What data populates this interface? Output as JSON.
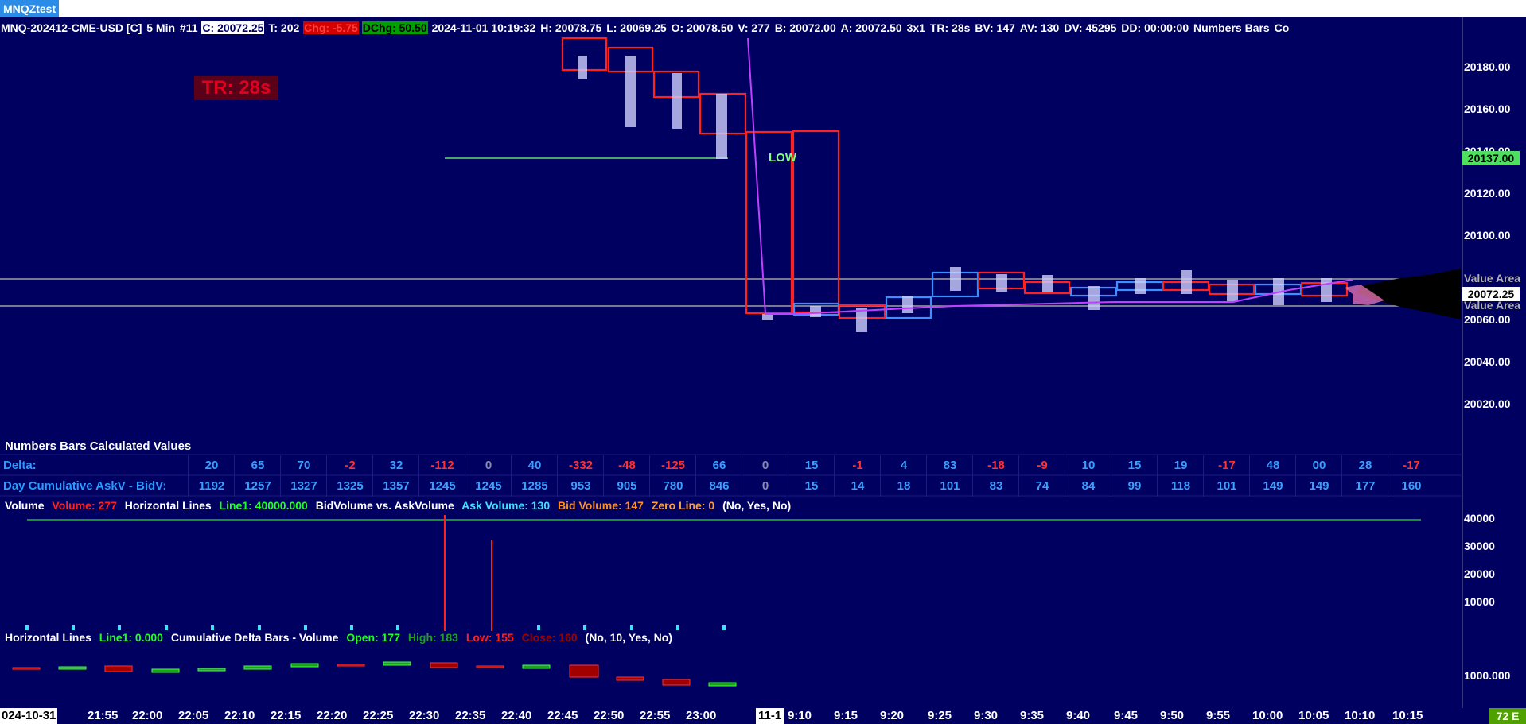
{
  "window": {
    "tab_title": "MNQZtest"
  },
  "header": {
    "symbol": "MNQ-202412-CME-USD [C]",
    "interval": "5 Min",
    "chart_number": "#11",
    "close": "C: 20072.25",
    "ticks": "T: 202",
    "change": "Chg: -5.75",
    "day_change": "DChg: 50.50",
    "datetime": "2024-11-01 10:19:32",
    "high": "H: 20078.75",
    "low": "L: 20069.25",
    "open": "O: 20078.50",
    "volume": "V: 277",
    "bid": "B: 20072.00",
    "ask": "A: 20072.50",
    "bar_type": "3x1",
    "time_remaining": "TR: 28s",
    "bid_volume": "BV: 147",
    "ask_volume": "AV: 130",
    "day_volume": "DV: 45295",
    "dd": "DD: 00:00:00",
    "study": "Numbers Bars",
    "tail": "Co"
  },
  "overlay": {
    "tr_badge": "TR: 28s",
    "low_label": "LOW",
    "value_area_high": "Value Area",
    "value_area_low": "Value Area"
  },
  "price_axis": {
    "labels": [
      "20180.00",
      "20160.00",
      "20140.00",
      "20120.00",
      "20100.00",
      "20060.00",
      "20040.00",
      "20020.00"
    ],
    "tag_line_price": "20137.00",
    "last_price": "20072.25"
  },
  "numbers_table": {
    "title": "Numbers Bars Calculated Values",
    "delta_label": "Delta:",
    "cum_label": "Day Cumulative AskV - BidV:",
    "delta": [
      "20",
      "65",
      "70",
      "-2",
      "32",
      "-112",
      "0",
      "40",
      "-332",
      "-48",
      "-125",
      "66",
      "0",
      "15",
      "-1",
      "4",
      "83",
      "-18",
      "-9",
      "10",
      "15",
      "19",
      "-17",
      "48",
      "00",
      "28",
      "-17"
    ],
    "cumulative": [
      "1192",
      "1257",
      "1327",
      "1325",
      "1357",
      "1245",
      "1245",
      "1285",
      "953",
      "905",
      "780",
      "846",
      "0",
      "15",
      "14",
      "18",
      "101",
      "83",
      "74",
      "84",
      "99",
      "118",
      "101",
      "149",
      "149",
      "177",
      "160"
    ]
  },
  "volume_pane": {
    "volume_label": "Volume",
    "volume_value": "Volume: 277",
    "hlines_label": "Horizontal Lines",
    "line1_value": "Line1: 40000.000",
    "bva_label": "BidVolume vs. AskVolume",
    "ask_value": "Ask Volume: 130",
    "bid_value": "Bid Volume: 147",
    "zero_value": "Zero Line: 0",
    "flags": "(No, Yes, No)",
    "axis": [
      "40000",
      "30000",
      "20000",
      "10000"
    ],
    "colors": {
      "volume": "#ff2020",
      "line1": "#20ff20",
      "ask": "#40e0ff",
      "bid": "#ff9020",
      "zero": "#ffa040"
    }
  },
  "cum_delta_pane": {
    "hlines_label": "Horizontal Lines",
    "line1_value": "Line1: 0.000",
    "study_label": "Cumulative Delta Bars - Volume",
    "open_value": "Open: 177",
    "high_value": "High: 183",
    "low_value": "Low: 155",
    "close_value": "Close: 160",
    "flags": "(No, 10, Yes, No)",
    "axis": [
      "1000.000"
    ]
  },
  "time_axis": {
    "date_left": "024-10-31",
    "date_mid": "11-1",
    "ticks": [
      "21:55",
      "22:00",
      "22:05",
      "22:10",
      "22:15",
      "22:20",
      "22:25",
      "22:30",
      "22:35",
      "22:40",
      "22:45",
      "22:50",
      "22:55",
      "23:00",
      "9:10",
      "9:15",
      "9:20",
      "9:25",
      "9:30",
      "9:35",
      "9:40",
      "9:45",
      "9:50",
      "9:55",
      "10:00",
      "10:05",
      "10:10",
      "10:15"
    ],
    "corner": "72 E"
  }
}
